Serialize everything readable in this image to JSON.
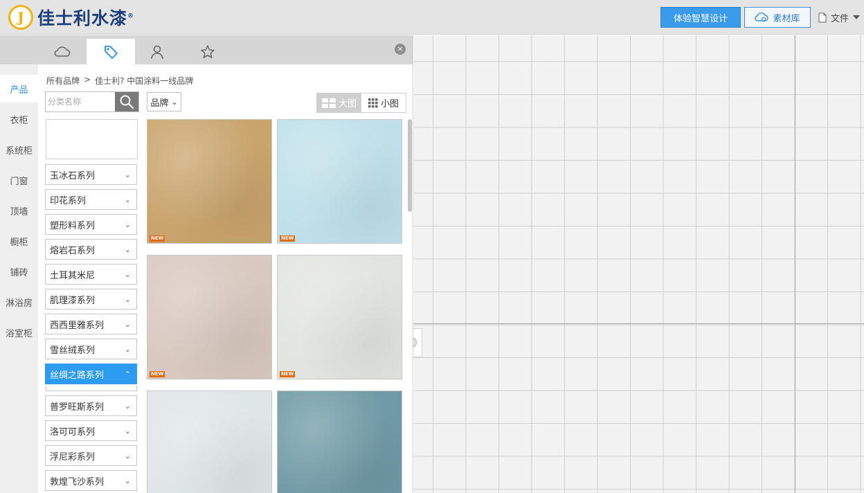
{
  "header": {
    "logo_char": "J",
    "logo_text": "佳士利水漆",
    "logo_reg": "®",
    "experience_button": "体验智慧设计",
    "materials_button": "素材库",
    "file_menu": "文件"
  },
  "tabs": [
    {
      "name": "cloud",
      "icon": "cloud-icon"
    },
    {
      "name": "tag",
      "icon": "tag-icon",
      "active": true
    },
    {
      "name": "user",
      "icon": "user-icon"
    },
    {
      "name": "star",
      "icon": "star-icon"
    }
  ],
  "close_glyph": "×",
  "categories": [
    "产品",
    "衣柜",
    "系统柜",
    "门窗",
    "顶墙",
    "橱柜",
    "铺砖",
    "淋浴房",
    "浴室柜"
  ],
  "breadcrumb": {
    "root": "所有品牌",
    "separator": ">",
    "current": "佳士利? 中国涂料一线品牌"
  },
  "search": {
    "placeholder": "分类名称"
  },
  "brand_select": "品牌",
  "view_toggle": {
    "large": "大图",
    "small": "小图"
  },
  "series": [
    {
      "label": "玉冰石系列"
    },
    {
      "label": "印花系列"
    },
    {
      "label": "塑形料系列"
    },
    {
      "label": "熔岩石系列"
    },
    {
      "label": "土耳其米尼"
    },
    {
      "label": "肌理漆系列"
    },
    {
      "label": "西西里雅系列"
    },
    {
      "label": "雪丝绒系列"
    },
    {
      "label": "丝绸之路系列",
      "active": true
    },
    {
      "label": "普罗旺斯系列"
    },
    {
      "label": "洛可可系列"
    },
    {
      "label": "浮尼彩系列"
    },
    {
      "label": "敦煌飞沙系列"
    }
  ],
  "chevrons": {
    "down": "⌄",
    "up": "⌃"
  },
  "new_badge": "NEW",
  "products": [
    {
      "color": "#c9a46c",
      "new": true
    },
    {
      "color": "#bfe0ea",
      "new": true
    },
    {
      "color": "#d8c8c0",
      "new": true
    },
    {
      "color": "#e2e4e0",
      "new": true
    },
    {
      "color": "#dfe6e8",
      "new": false
    },
    {
      "color": "#6f9aa6",
      "new": false
    }
  ],
  "collapse_glyph": "》",
  "colors": {
    "accent": "#2d9bef",
    "brand_blue": "#1b3f7a",
    "brand_yellow": "#f2b300"
  }
}
